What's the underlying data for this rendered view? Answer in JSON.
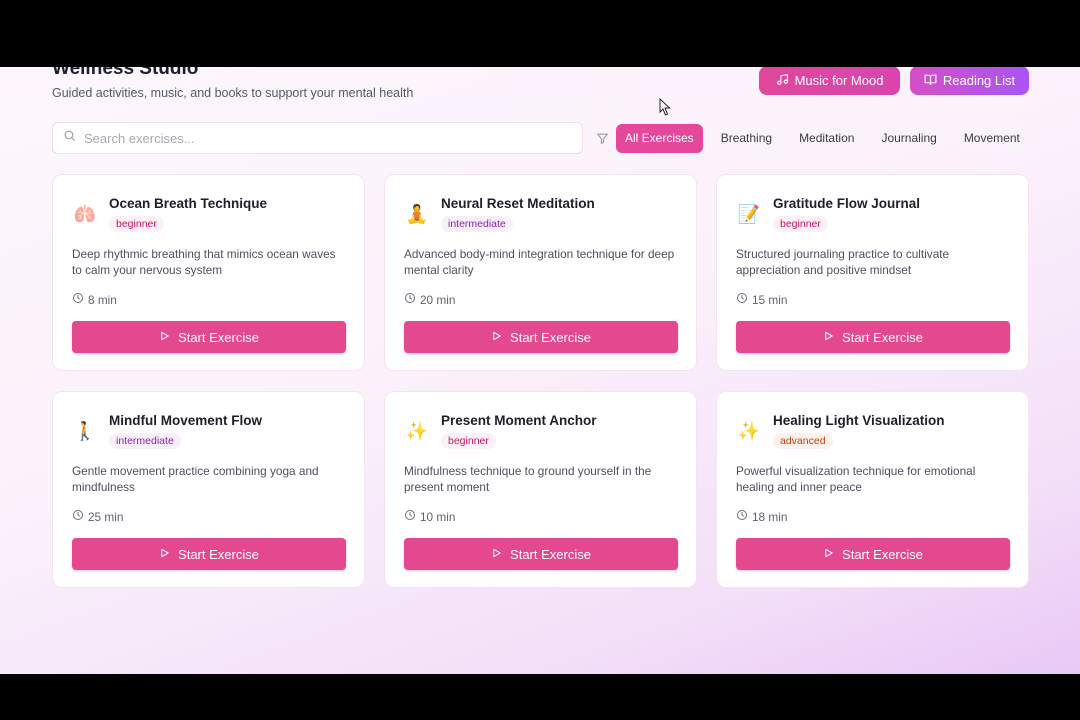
{
  "header": {
    "title": "Wellness Studio",
    "subtitle": "Guided activities, music, and books to support your mental health"
  },
  "actions": {
    "music_label": "Music for Mood",
    "music_icon": "music-note-icon",
    "reading_label": "Reading List",
    "reading_icon": "book-open-icon"
  },
  "search": {
    "placeholder": "Search exercises...",
    "value": ""
  },
  "filters": [
    {
      "label": "All Exercises",
      "active": true
    },
    {
      "label": "Breathing",
      "active": false
    },
    {
      "label": "Meditation",
      "active": false
    },
    {
      "label": "Journaling",
      "active": false
    },
    {
      "label": "Movement",
      "active": false
    }
  ],
  "exercises": [
    {
      "icon": "🫁",
      "title": "Ocean Breath Technique",
      "level": "beginner",
      "description": "Deep rhythmic breathing that mimics ocean waves to calm your nervous system",
      "duration": "8 min",
      "button": "Start Exercise"
    },
    {
      "icon": "🧘",
      "title": "Neural Reset Meditation",
      "level": "intermediate",
      "description": "Advanced body-mind integration technique for deep mental clarity",
      "duration": "20 min",
      "button": "Start Exercise"
    },
    {
      "icon": "📝",
      "title": "Gratitude Flow Journal",
      "level": "beginner",
      "description": "Structured journaling practice to cultivate appreciation and positive mindset",
      "duration": "15 min",
      "button": "Start Exercise"
    },
    {
      "icon": "🚶",
      "title": "Mindful Movement Flow",
      "level": "intermediate",
      "description": "Gentle movement practice combining yoga and mindfulness",
      "duration": "25 min",
      "button": "Start Exercise"
    },
    {
      "icon": "✨",
      "title": "Present Moment Anchor",
      "level": "beginner",
      "description": "Mindfulness technique to ground yourself in the present moment",
      "duration": "10 min",
      "button": "Start Exercise"
    },
    {
      "icon": "✨",
      "title": "Healing Light Visualization",
      "level": "advanced",
      "description": "Powerful visualization technique for emotional healing and inner peace",
      "duration": "18 min",
      "button": "Start Exercise"
    }
  ],
  "colors": {
    "accent": "#e4488f",
    "accent_purple": "#a855f7"
  }
}
